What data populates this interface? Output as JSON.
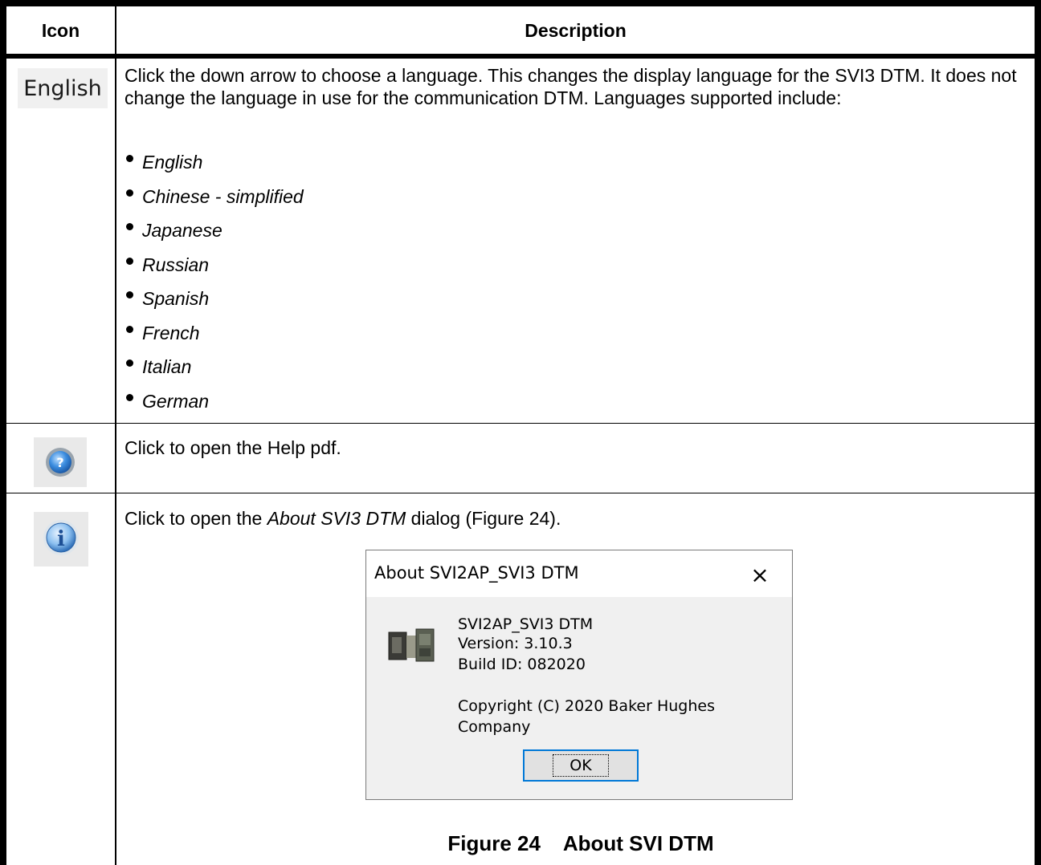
{
  "table": {
    "header_icon": "Icon",
    "header_description": "Description"
  },
  "rows": {
    "language": {
      "icon_text": "English",
      "description": "Click the down arrow to choose a language. This changes the display language for the SVI3 DTM. It does not change the language in use for the communication DTM. Languages supported include:",
      "languages": [
        "English",
        "Chinese - simplified",
        "Japanese",
        "Russian",
        "Spanish",
        "French",
        "Italian",
        "German"
      ]
    },
    "help": {
      "icon": "help-icon",
      "description": "Click to open the Help pdf."
    },
    "about": {
      "icon": "info-icon",
      "description_pre": "Click to open the ",
      "description_italic": "About SVI3 DTM",
      "description_post": " dialog (Figure 24)."
    }
  },
  "dialog": {
    "title": "About SVI2AP_SVI3 DTM",
    "close_label": "×",
    "product": "SVI2AP_SVI3 DTM",
    "version": "Version: 3.10.3",
    "build_id": "Build ID: 082020",
    "copyright_line1": "Copyright (C) 2020 Baker Hughes",
    "copyright_line2": "Company",
    "ok_label": "OK",
    "device_icon": "device-icon"
  },
  "caption": {
    "figure_number": "Figure 24",
    "figure_title": "About SVI DTM"
  }
}
